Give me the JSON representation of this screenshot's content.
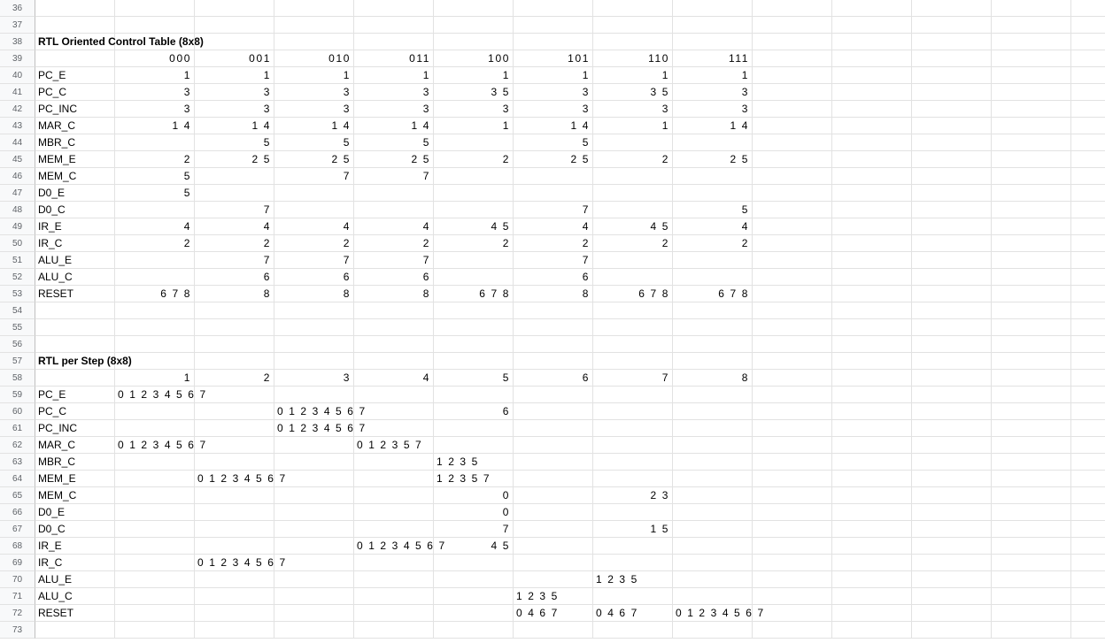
{
  "sheet": {
    "first_row": 36,
    "last_row": 73,
    "rows": {
      "38": [
        {
          "col": 0,
          "text": "RTL Oriented Control Table (8x8)",
          "bold": true
        }
      ],
      "39": [
        {
          "col": 1,
          "text": "000",
          "align": "right"
        },
        {
          "col": 2,
          "text": "001",
          "align": "right"
        },
        {
          "col": 3,
          "text": "010",
          "align": "right"
        },
        {
          "col": 4,
          "text": "011",
          "align": "right"
        },
        {
          "col": 5,
          "text": "100",
          "align": "right"
        },
        {
          "col": 6,
          "text": "101",
          "align": "right"
        },
        {
          "col": 7,
          "text": "110",
          "align": "right"
        },
        {
          "col": 8,
          "text": "111",
          "align": "right"
        }
      ],
      "40": [
        {
          "col": 0,
          "text": "PC_E"
        },
        {
          "col": 1,
          "text": "1",
          "align": "right"
        },
        {
          "col": 2,
          "text": "1",
          "align": "right"
        },
        {
          "col": 3,
          "text": "1",
          "align": "right"
        },
        {
          "col": 4,
          "text": "1",
          "align": "right"
        },
        {
          "col": 5,
          "text": "1",
          "align": "right"
        },
        {
          "col": 6,
          "text": "1",
          "align": "right"
        },
        {
          "col": 7,
          "text": "1",
          "align": "right"
        },
        {
          "col": 8,
          "text": "1",
          "align": "right"
        }
      ],
      "41": [
        {
          "col": 0,
          "text": "PC_C"
        },
        {
          "col": 1,
          "text": "3",
          "align": "right"
        },
        {
          "col": 2,
          "text": "3",
          "align": "right"
        },
        {
          "col": 3,
          "text": "3",
          "align": "right"
        },
        {
          "col": 4,
          "text": "3",
          "align": "right"
        },
        {
          "col": 5,
          "text": "3 5",
          "align": "right"
        },
        {
          "col": 6,
          "text": "3",
          "align": "right"
        },
        {
          "col": 7,
          "text": "3 5",
          "align": "right"
        },
        {
          "col": 8,
          "text": "3",
          "align": "right"
        }
      ],
      "42": [
        {
          "col": 0,
          "text": "PC_INC"
        },
        {
          "col": 1,
          "text": "3",
          "align": "right"
        },
        {
          "col": 2,
          "text": "3",
          "align": "right"
        },
        {
          "col": 3,
          "text": "3",
          "align": "right"
        },
        {
          "col": 4,
          "text": "3",
          "align": "right"
        },
        {
          "col": 5,
          "text": "3",
          "align": "right"
        },
        {
          "col": 6,
          "text": "3",
          "align": "right"
        },
        {
          "col": 7,
          "text": "3",
          "align": "right"
        },
        {
          "col": 8,
          "text": "3",
          "align": "right"
        }
      ],
      "43": [
        {
          "col": 0,
          "text": "MAR_C"
        },
        {
          "col": 1,
          "text": "1 4",
          "align": "right"
        },
        {
          "col": 2,
          "text": "1 4",
          "align": "right"
        },
        {
          "col": 3,
          "text": "1 4",
          "align": "right"
        },
        {
          "col": 4,
          "text": "1 4",
          "align": "right"
        },
        {
          "col": 5,
          "text": "1",
          "align": "right"
        },
        {
          "col": 6,
          "text": "1 4",
          "align": "right"
        },
        {
          "col": 7,
          "text": "1",
          "align": "right"
        },
        {
          "col": 8,
          "text": "1 4",
          "align": "right"
        }
      ],
      "44": [
        {
          "col": 0,
          "text": "MBR_C"
        },
        {
          "col": 2,
          "text": "5",
          "align": "right"
        },
        {
          "col": 3,
          "text": "5",
          "align": "right"
        },
        {
          "col": 4,
          "text": "5",
          "align": "right"
        },
        {
          "col": 6,
          "text": "5",
          "align": "right"
        }
      ],
      "45": [
        {
          "col": 0,
          "text": "MEM_E"
        },
        {
          "col": 1,
          "text": "2",
          "align": "right"
        },
        {
          "col": 2,
          "text": "2 5",
          "align": "right"
        },
        {
          "col": 3,
          "text": "2 5",
          "align": "right"
        },
        {
          "col": 4,
          "text": "2 5",
          "align": "right"
        },
        {
          "col": 5,
          "text": "2",
          "align": "right"
        },
        {
          "col": 6,
          "text": "2 5",
          "align": "right"
        },
        {
          "col": 7,
          "text": "2",
          "align": "right"
        },
        {
          "col": 8,
          "text": "2 5",
          "align": "right"
        }
      ],
      "46": [
        {
          "col": 0,
          "text": "MEM_C"
        },
        {
          "col": 1,
          "text": "5",
          "align": "right"
        },
        {
          "col": 3,
          "text": "7",
          "align": "right"
        },
        {
          "col": 4,
          "text": "7",
          "align": "right"
        }
      ],
      "47": [
        {
          "col": 0,
          "text": "D0_E"
        },
        {
          "col": 1,
          "text": "5",
          "align": "right"
        }
      ],
      "48": [
        {
          "col": 0,
          "text": "D0_C"
        },
        {
          "col": 2,
          "text": "7",
          "align": "right"
        },
        {
          "col": 6,
          "text": "7",
          "align": "right"
        },
        {
          "col": 8,
          "text": "5",
          "align": "right"
        }
      ],
      "49": [
        {
          "col": 0,
          "text": "IR_E"
        },
        {
          "col": 1,
          "text": "4",
          "align": "right"
        },
        {
          "col": 2,
          "text": "4",
          "align": "right"
        },
        {
          "col": 3,
          "text": "4",
          "align": "right"
        },
        {
          "col": 4,
          "text": "4",
          "align": "right"
        },
        {
          "col": 5,
          "text": "4 5",
          "align": "right"
        },
        {
          "col": 6,
          "text": "4",
          "align": "right"
        },
        {
          "col": 7,
          "text": "4 5",
          "align": "right"
        },
        {
          "col": 8,
          "text": "4",
          "align": "right"
        }
      ],
      "50": [
        {
          "col": 0,
          "text": "IR_C"
        },
        {
          "col": 1,
          "text": "2",
          "align": "right"
        },
        {
          "col": 2,
          "text": "2",
          "align": "right"
        },
        {
          "col": 3,
          "text": "2",
          "align": "right"
        },
        {
          "col": 4,
          "text": "2",
          "align": "right"
        },
        {
          "col": 5,
          "text": "2",
          "align": "right"
        },
        {
          "col": 6,
          "text": "2",
          "align": "right"
        },
        {
          "col": 7,
          "text": "2",
          "align": "right"
        },
        {
          "col": 8,
          "text": "2",
          "align": "right"
        }
      ],
      "51": [
        {
          "col": 0,
          "text": "ALU_E"
        },
        {
          "col": 2,
          "text": "7",
          "align": "right"
        },
        {
          "col": 3,
          "text": "7",
          "align": "right"
        },
        {
          "col": 4,
          "text": "7",
          "align": "right"
        },
        {
          "col": 6,
          "text": "7",
          "align": "right"
        }
      ],
      "52": [
        {
          "col": 0,
          "text": "ALU_C"
        },
        {
          "col": 2,
          "text": "6",
          "align": "right"
        },
        {
          "col": 3,
          "text": "6",
          "align": "right"
        },
        {
          "col": 4,
          "text": "6",
          "align": "right"
        },
        {
          "col": 6,
          "text": "6",
          "align": "right"
        }
      ],
      "53": [
        {
          "col": 0,
          "text": "RESET"
        },
        {
          "col": 1,
          "text": "6 7 8",
          "align": "right"
        },
        {
          "col": 2,
          "text": "8",
          "align": "right"
        },
        {
          "col": 3,
          "text": "8",
          "align": "right"
        },
        {
          "col": 4,
          "text": "8",
          "align": "right"
        },
        {
          "col": 5,
          "text": "6 7 8",
          "align": "right"
        },
        {
          "col": 6,
          "text": "8",
          "align": "right"
        },
        {
          "col": 7,
          "text": "6 7 8",
          "align": "right"
        },
        {
          "col": 8,
          "text": "6 7 8",
          "align": "right"
        }
      ],
      "57": [
        {
          "col": 0,
          "text": "RTL per Step (8x8)",
          "bold": true
        }
      ],
      "58": [
        {
          "col": 1,
          "text": "1",
          "align": "right"
        },
        {
          "col": 2,
          "text": "2",
          "align": "right"
        },
        {
          "col": 3,
          "text": "3",
          "align": "right"
        },
        {
          "col": 4,
          "text": "4",
          "align": "right"
        },
        {
          "col": 5,
          "text": "5",
          "align": "right"
        },
        {
          "col": 6,
          "text": "6",
          "align": "right"
        },
        {
          "col": 7,
          "text": "7",
          "align": "right"
        },
        {
          "col": 8,
          "text": "8",
          "align": "right"
        }
      ],
      "59": [
        {
          "col": 0,
          "text": "PC_E"
        },
        {
          "col": 1,
          "text": "0 1 2 3 4 5 6 7"
        }
      ],
      "60": [
        {
          "col": 0,
          "text": "PC_C"
        },
        {
          "col": 3,
          "text": "0 1 2 3 4 5 6 7"
        },
        {
          "col": 5,
          "text": "6",
          "align": "right"
        }
      ],
      "61": [
        {
          "col": 0,
          "text": "PC_INC"
        },
        {
          "col": 3,
          "text": "0 1 2 3 4 5 6 7"
        }
      ],
      "62": [
        {
          "col": 0,
          "text": "MAR_C"
        },
        {
          "col": 1,
          "text": "0 1 2 3 4 5 6 7"
        },
        {
          "col": 4,
          "text": "0 1 2 3 5 7"
        }
      ],
      "63": [
        {
          "col": 0,
          "text": "MBR_C"
        },
        {
          "col": 5,
          "text": "1 2 3 5"
        }
      ],
      "64": [
        {
          "col": 0,
          "text": "MEM_E"
        },
        {
          "col": 2,
          "text": "0 1 2 3 4 5 6 7"
        },
        {
          "col": 5,
          "text": "1 2 3 5 7"
        }
      ],
      "65": [
        {
          "col": 0,
          "text": "MEM_C"
        },
        {
          "col": 5,
          "text": "0",
          "align": "right"
        },
        {
          "col": 7,
          "text": "2 3",
          "align": "right"
        }
      ],
      "66": [
        {
          "col": 0,
          "text": "D0_E"
        },
        {
          "col": 5,
          "text": "0",
          "align": "right"
        }
      ],
      "67": [
        {
          "col": 0,
          "text": "D0_C"
        },
        {
          "col": 5,
          "text": "7",
          "align": "right"
        },
        {
          "col": 7,
          "text": "1 5",
          "align": "right"
        }
      ],
      "68": [
        {
          "col": 0,
          "text": "IR_E"
        },
        {
          "col": 4,
          "text": "0 1 2 3 4 5 6 7"
        },
        {
          "col": 5,
          "text": "4 5",
          "align": "right"
        }
      ],
      "69": [
        {
          "col": 0,
          "text": "IR_C"
        },
        {
          "col": 2,
          "text": "0 1 2 3 4 5 6 7"
        }
      ],
      "70": [
        {
          "col": 0,
          "text": "ALU_E"
        },
        {
          "col": 7,
          "text": "1 2 3 5"
        }
      ],
      "71": [
        {
          "col": 0,
          "text": "ALU_C"
        },
        {
          "col": 6,
          "text": "1 2 3 5"
        }
      ],
      "72": [
        {
          "col": 0,
          "text": "RESET"
        },
        {
          "col": 6,
          "text": "0 4 6 7"
        },
        {
          "col": 7,
          "text": "0 4 6 7"
        },
        {
          "col": 8,
          "text": "0 1 2 3 4 5 6 7"
        }
      ]
    }
  }
}
